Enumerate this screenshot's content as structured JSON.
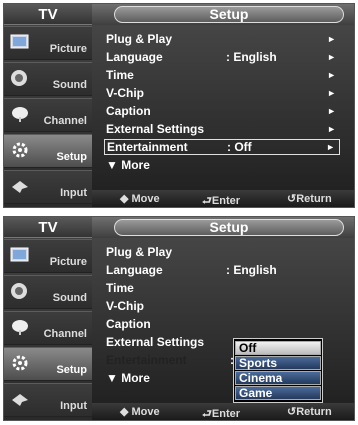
{
  "panel1": {
    "sidebar": {
      "title": "TV",
      "items": [
        {
          "label": "Picture",
          "icon": "picture-icon"
        },
        {
          "label": "Sound",
          "icon": "sound-icon"
        },
        {
          "label": "Channel",
          "icon": "channel-icon"
        },
        {
          "label": "Setup",
          "icon": "setup-icon"
        },
        {
          "label": "Input",
          "icon": "input-icon"
        }
      ]
    },
    "header": {
      "title": "Setup"
    },
    "menu": [
      {
        "label": "Plug & Play",
        "value": "",
        "arrow": "►"
      },
      {
        "label": "Language",
        "value": ": English",
        "arrow": "►"
      },
      {
        "label": "Time",
        "value": "",
        "arrow": "►"
      },
      {
        "label": "V-Chip",
        "value": "",
        "arrow": "►"
      },
      {
        "label": "Caption",
        "value": "",
        "arrow": "►"
      },
      {
        "label": "External Settings",
        "value": "",
        "arrow": "►"
      },
      {
        "label": "Entertainment",
        "value": ": Off",
        "arrow": "►"
      },
      {
        "label": "▼ More",
        "value": "",
        "arrow": ""
      }
    ],
    "footer": {
      "move": "◆ Move",
      "enter": "⮐Enter",
      "return": "↺Return"
    }
  },
  "panel2": {
    "sidebar": {
      "title": "TV",
      "items": [
        {
          "label": "Picture",
          "icon": "picture-icon"
        },
        {
          "label": "Sound",
          "icon": "sound-icon"
        },
        {
          "label": "Channel",
          "icon": "channel-icon"
        },
        {
          "label": "Setup",
          "icon": "setup-icon"
        },
        {
          "label": "Input",
          "icon": "input-icon"
        }
      ]
    },
    "header": {
      "title": "Setup"
    },
    "menu": [
      {
        "label": "Plug & Play",
        "value": "",
        "arrow": ""
      },
      {
        "label": "Language",
        "value": ": English",
        "arrow": ""
      },
      {
        "label": "Time",
        "value": "",
        "arrow": ""
      },
      {
        "label": "V-Chip",
        "value": "",
        "arrow": ""
      },
      {
        "label": "Caption",
        "value": "",
        "arrow": ""
      },
      {
        "label": "External Settings",
        "value": "",
        "arrow": ""
      },
      {
        "label": "Entertainment",
        "value": ":",
        "arrow": ""
      },
      {
        "label": "▼ More",
        "value": "",
        "arrow": ""
      }
    ],
    "dropdown": {
      "options": [
        "Off",
        "Sports",
        "Cinema",
        "Game"
      ],
      "selected": "Off"
    },
    "footer": {
      "move": "◆ Move",
      "enter": "⮐Enter",
      "return": "↺Return"
    }
  },
  "colors": {
    "highlight": "#e8e8e8",
    "dropdown_option": "#2f4f80",
    "panel_bg": "#000000"
  }
}
